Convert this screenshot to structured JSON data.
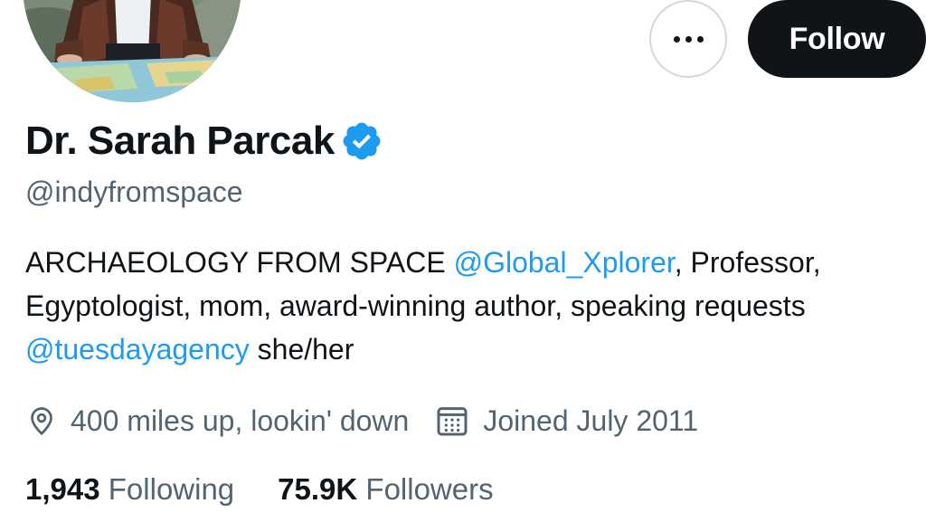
{
  "profile": {
    "name": "Dr. Sarah Parcak",
    "handle": "@indyfromspace",
    "bio_parts": {
      "p1": "ARCHAEOLOGY FROM SPACE ",
      "mention1": "@Global_Xplorer",
      "p2": ", Professor, Egyptologist, mom, award-winning author, speaking requests ",
      "mention2": "@tuesdayagency",
      "p3": " she/her"
    },
    "location": "400 miles up, lookin' down",
    "joined": "Joined July 2011"
  },
  "actions": {
    "follow_label": "Follow",
    "more_icon": "ellipsis-icon"
  },
  "stats": {
    "following_count": "1,943",
    "following_label": "Following",
    "followers_count": "75.9K",
    "followers_label": "Followers"
  },
  "colors": {
    "accent": "#1d9bf0",
    "text": "#0f1419",
    "muted": "#536471",
    "follow_bg": "#0f1419"
  }
}
